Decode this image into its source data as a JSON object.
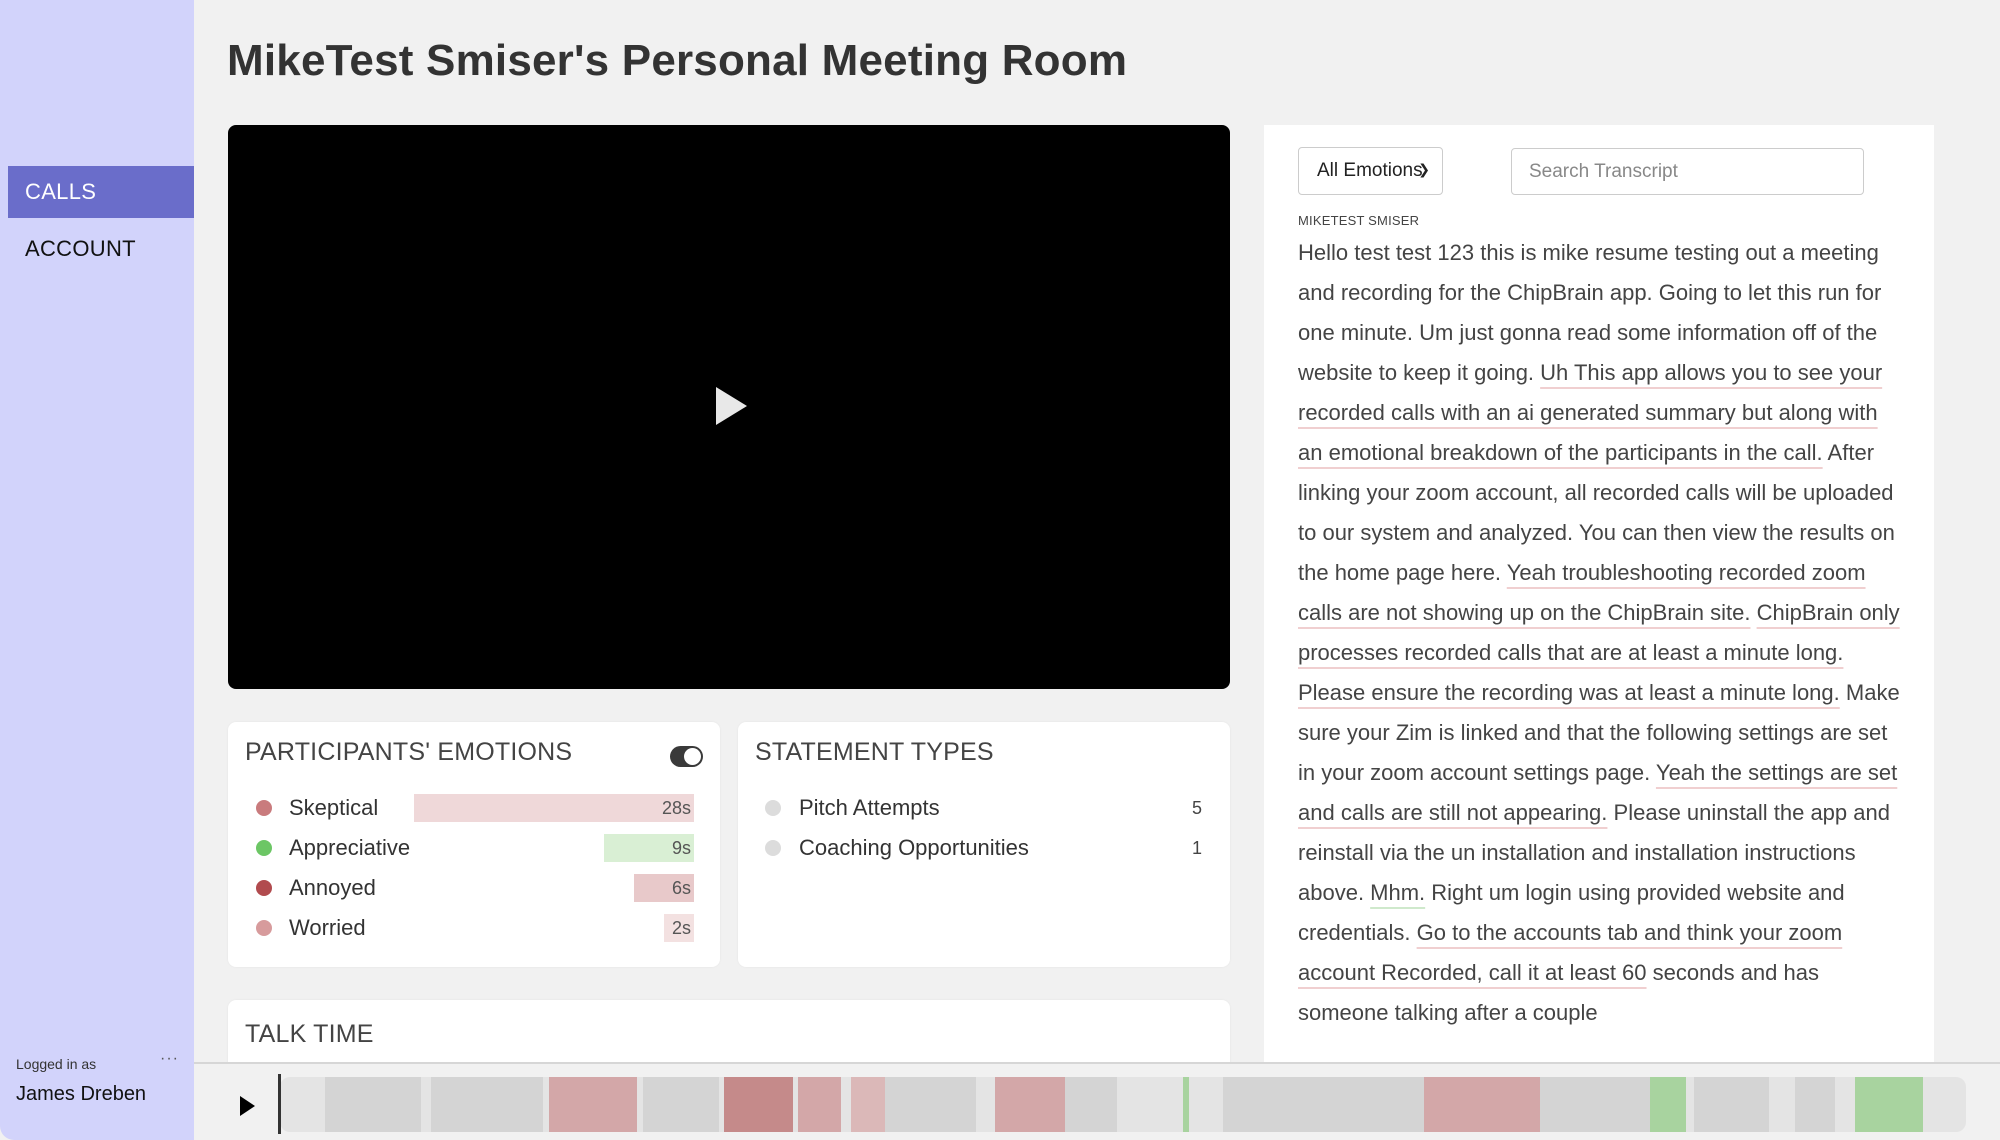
{
  "sidebar": {
    "nav": [
      {
        "label": "CALLS",
        "active": true
      },
      {
        "label": "ACCOUNT",
        "active": false
      }
    ],
    "logged_in_label": "Logged in as",
    "more_label": "···",
    "user_name": "James Dreben"
  },
  "page": {
    "title": "MikeTest Smiser's Personal Meeting Room"
  },
  "emotions": {
    "title": "PARTICIPANTS' EMOTIONS",
    "toggle_on": true,
    "max_seconds": 28,
    "items": [
      {
        "label": "Skeptical",
        "value": "28s",
        "seconds": 28,
        "dot_color": "#c97b7d",
        "bar_color": "#efd8d9"
      },
      {
        "label": "Appreciative",
        "value": "9s",
        "seconds": 9,
        "dot_color": "#6cc665",
        "bar_color": "#d9efd4"
      },
      {
        "label": "Annoyed",
        "value": "6s",
        "seconds": 6,
        "dot_color": "#b14b4e",
        "bar_color": "#e8c9ca"
      },
      {
        "label": "Worried",
        "value": "2s",
        "seconds": 2,
        "dot_color": "#d79b9c",
        "bar_color": "#f3e1e1"
      }
    ]
  },
  "statements": {
    "title": "STATEMENT TYPES",
    "items": [
      {
        "label": "Pitch Attempts",
        "value": "5"
      },
      {
        "label": "Coaching Opportunities",
        "value": "1"
      }
    ]
  },
  "talk_time": {
    "title": "TALK TIME"
  },
  "transcript": {
    "filter_value": "All Emotions",
    "search_placeholder": "Search Transcript",
    "speaker": "MIKETEST SMISER",
    "segments": [
      {
        "text": "Hello test test 123 this is mike resume testing out a meeting and recording for the ChipBrain app. Going to let this run for one minute. Um just gonna read some information off of the website to keep it going. ",
        "tone": "none"
      },
      {
        "text": "Uh This app allows you to see your recorded calls with an ai generated summary but along with an emotional breakdown of the participants in the call.",
        "tone": "neg"
      },
      {
        "text": " After linking your zoom account, all recorded calls will be uploaded to our system and analyzed. You can then view the results on the home page here. ",
        "tone": "none"
      },
      {
        "text": "Yeah troubleshooting recorded zoom calls are not showing up on the ChipBrain site.",
        "tone": "neg"
      },
      {
        "text": " ",
        "tone": "none"
      },
      {
        "text": "ChipBrain only processes recorded calls that are at least a minute long.",
        "tone": "neg"
      },
      {
        "text": " ",
        "tone": "none"
      },
      {
        "text": "Please ensure the recording was at least a minute long.",
        "tone": "neg"
      },
      {
        "text": " Make sure your Zim is linked and that the following settings are set in your zoom account settings page. ",
        "tone": "none"
      },
      {
        "text": "Yeah the settings are set and calls are still not appearing.",
        "tone": "neg"
      },
      {
        "text": " Please uninstall the app and reinstall via the un installation and installation instructions above. ",
        "tone": "none"
      },
      {
        "text": "Mhm.",
        "tone": "pos"
      },
      {
        "text": " Right um login using provided website and credentials. ",
        "tone": "none"
      },
      {
        "text": "Go to the accounts tab and think your zoom account Recorded, call it at least 60",
        "tone": "neg"
      },
      {
        "text": " seconds and has someone talking after a couple",
        "tone": "none"
      }
    ]
  },
  "player": {
    "progress": 0,
    "colors": {
      "empty": "#e4e4e4",
      "neutral": "#d4d4d4",
      "skeptical": "#d3a7a8",
      "annoyed": "#c58a8a",
      "worried": "#dbb8b8",
      "appreciative": "#a8d39f"
    },
    "timeline": [
      {
        "start": 0.0267,
        "end": 0.0836,
        "type": "neutral"
      },
      {
        "start": 0.0896,
        "end": 0.156,
        "type": "neutral"
      },
      {
        "start": 0.1596,
        "end": 0.2117,
        "type": "skeptical"
      },
      {
        "start": 0.2153,
        "end": 0.2604,
        "type": "neutral"
      },
      {
        "start": 0.2633,
        "end": 0.3043,
        "type": "annoyed"
      },
      {
        "start": 0.3072,
        "end": 0.3327,
        "type": "skeptical"
      },
      {
        "start": 0.3387,
        "end": 0.3588,
        "type": "worried"
      },
      {
        "start": 0.3588,
        "end": 0.4128,
        "type": "neutral"
      },
      {
        "start": 0.4241,
        "end": 0.4656,
        "type": "skeptical"
      },
      {
        "start": 0.4656,
        "end": 0.4964,
        "type": "neutral"
      },
      {
        "start": 0.5356,
        "end": 0.5391,
        "type": "appreciative"
      },
      {
        "start": 0.5593,
        "end": 0.6785,
        "type": "neutral"
      },
      {
        "start": 0.6785,
        "end": 0.7473,
        "type": "skeptical"
      },
      {
        "start": 0.7473,
        "end": 0.8126,
        "type": "neutral"
      },
      {
        "start": 0.8126,
        "end": 0.8339,
        "type": "appreciative"
      },
      {
        "start": 0.8387,
        "end": 0.8832,
        "type": "neutral"
      },
      {
        "start": 0.8986,
        "end": 0.9223,
        "type": "neutral"
      },
      {
        "start": 0.9342,
        "end": 0.9745,
        "type": "appreciative"
      }
    ]
  }
}
